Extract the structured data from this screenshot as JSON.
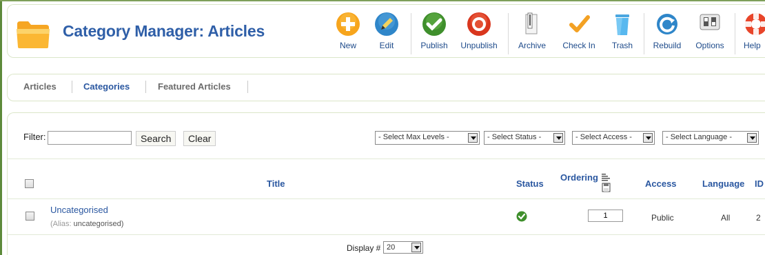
{
  "header": {
    "title": "Category Manager: Articles"
  },
  "toolbar": {
    "buttons": [
      {
        "label": "New",
        "icon": "plus-icon"
      },
      {
        "label": "Edit",
        "icon": "pencil-icon"
      },
      {
        "label": "Publish",
        "icon": "checkmark-circle-icon"
      },
      {
        "label": "Unpublish",
        "icon": "stop-circle-icon"
      },
      {
        "label": "Archive",
        "icon": "archive-icon"
      },
      {
        "label": "Check In",
        "icon": "checkin-icon"
      },
      {
        "label": "Trash",
        "icon": "trash-icon"
      },
      {
        "label": "Rebuild",
        "icon": "rebuild-icon"
      },
      {
        "label": "Options",
        "icon": "options-icon"
      },
      {
        "label": "Help",
        "icon": "lifebuoy-icon"
      }
    ]
  },
  "submenu": {
    "items": [
      {
        "label": "Articles",
        "active": false
      },
      {
        "label": "Categories",
        "active": true
      },
      {
        "label": "Featured Articles",
        "active": false
      }
    ]
  },
  "filter": {
    "label": "Filter:",
    "value": "",
    "search_label": "Search",
    "clear_label": "Clear",
    "selects": [
      {
        "label": "- Select Max Levels -"
      },
      {
        "label": "- Select Status -"
      },
      {
        "label": "- Select Access -"
      },
      {
        "label": "- Select Language -"
      }
    ]
  },
  "table": {
    "headers": {
      "title": "Title",
      "status": "Status",
      "ordering": "Ordering",
      "access": "Access",
      "language": "Language",
      "id": "ID"
    },
    "rows": [
      {
        "title": "Uncategorised",
        "alias_label": "(Alias:",
        "alias_value": "uncategorised)",
        "status": "published",
        "ordering": "1",
        "access": "Public",
        "language": "All",
        "id": "2"
      }
    ]
  },
  "footer": {
    "display_label": "Display #",
    "display_value": "20"
  },
  "colors": {
    "accent": "#2a57a0",
    "border": "#dbe6c8",
    "frame": "#5d8a3a"
  }
}
